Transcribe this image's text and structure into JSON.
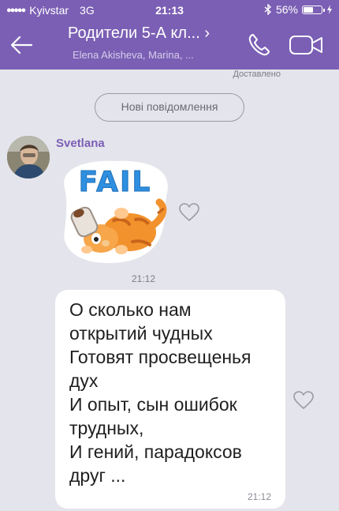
{
  "status_bar": {
    "carrier": "Kyivstar",
    "network": "3G",
    "time": "21:13",
    "battery_percent": "56%",
    "battery_level": 0.56
  },
  "header": {
    "title": "Родители 5-А кл... ›",
    "subtitle": "Elena Akisheva, Marina, ...",
    "background_color": "#7b5fb4"
  },
  "chat": {
    "delivered_label": "Доставлено",
    "new_messages_label": "Нові повідомлення",
    "sender_name": "Svetlana",
    "sticker": {
      "text": "FAIL",
      "time": "21:12"
    },
    "message": {
      "lines": [
        "О сколько нам",
        "открытий чудных",
        "Готовят просвещенья",
        "дух",
        "И опыт, сын ошибок",
        "трудных,",
        "И гений, парадоксов",
        "друг ..."
      ],
      "time": "21:12"
    }
  },
  "icons": {
    "back": "back-arrow-icon",
    "call": "phone-icon",
    "video": "video-call-icon",
    "like": "heart-outline-icon",
    "bluetooth": "bluetooth-icon",
    "charging": "charging-bolt-icon"
  }
}
